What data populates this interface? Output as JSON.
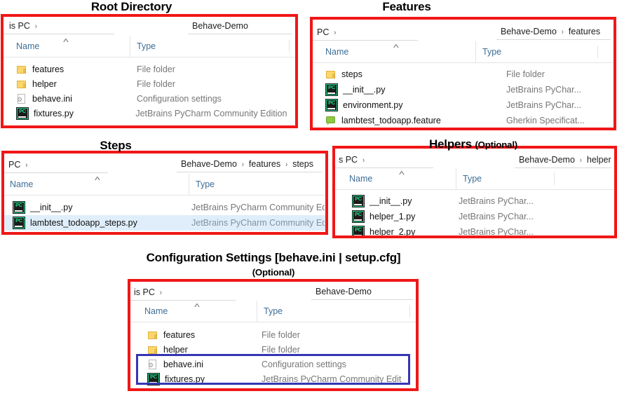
{
  "panels": [
    {
      "title": "Root Directory",
      "title_sub": "",
      "breadcrumb_left": "is PC",
      "breadcrumb_right": [
        "Behave-Demo"
      ],
      "columns": {
        "name": "Name",
        "type": "Type"
      },
      "rows": [
        {
          "name": "features",
          "type": "File folder",
          "icon": "folder-icon",
          "selected": false
        },
        {
          "name": "helper",
          "type": "File folder",
          "icon": "folder-icon",
          "selected": false
        },
        {
          "name": "behave.ini",
          "type": "Configuration settings",
          "icon": "ini-file-icon",
          "selected": false
        },
        {
          "name": "fixtures.py",
          "type": "JetBrains PyCharm Community Edition",
          "icon": "pycharm-icon",
          "selected": false
        }
      ]
    },
    {
      "title": "Features",
      "title_sub": "",
      "breadcrumb_left": "PC",
      "breadcrumb_right": [
        "Behave-Demo",
        "features"
      ],
      "columns": {
        "name": "Name",
        "type": "Type"
      },
      "rows": [
        {
          "name": "steps",
          "type": "File folder",
          "icon": "folder-icon",
          "selected": false
        },
        {
          "name": "__init__.py",
          "type": "JetBrains PyChar...",
          "icon": "pycharm-icon",
          "selected": false
        },
        {
          "name": "environment.py",
          "type": "JetBrains PyChar...",
          "icon": "pycharm-icon",
          "selected": false
        },
        {
          "name": "lambtest_todoapp.feature",
          "type": "Gherkin Specificat...",
          "icon": "gherkin-icon",
          "selected": false
        }
      ]
    },
    {
      "title": "Steps",
      "title_sub": "",
      "breadcrumb_left": "PC",
      "breadcrumb_right": [
        "Behave-Demo",
        "features",
        "steps"
      ],
      "columns": {
        "name": "Name",
        "type": "Type"
      },
      "rows": [
        {
          "name": "__init__.py",
          "type": "JetBrains PyCharm Community Ed",
          "icon": "pycharm-icon",
          "selected": false
        },
        {
          "name": "lambtest_todoapp_steps.py",
          "type": "JetBrains PyCharm Community Ed",
          "icon": "pycharm-icon",
          "selected": true
        }
      ]
    },
    {
      "title": "Helpers",
      "title_sub": "(Optional)",
      "breadcrumb_left": "s PC",
      "breadcrumb_right": [
        "Behave-Demo",
        "helper"
      ],
      "columns": {
        "name": "Name",
        "type": "Type"
      },
      "rows": [
        {
          "name": "__init__.py",
          "type": "JetBrains PyChar...",
          "icon": "pycharm-icon",
          "selected": false
        },
        {
          "name": "helper_1.py",
          "type": "JetBrains PyChar...",
          "icon": "pycharm-icon",
          "selected": false
        },
        {
          "name": "helper_2.py",
          "type": "JetBrains PyChar...",
          "icon": "pycharm-icon",
          "selected": false
        }
      ]
    },
    {
      "title": "Configuration Settings [behave.ini | setup.cfg]",
      "title_sub": "(Optional)",
      "breadcrumb_left": "is PC",
      "breadcrumb_right": [
        "Behave-Demo"
      ],
      "columns": {
        "name": "Name",
        "type": "Type"
      },
      "rows": [
        {
          "name": "features",
          "type": "File folder",
          "icon": "folder-icon",
          "selected": false
        },
        {
          "name": "helper",
          "type": "File folder",
          "icon": "folder-icon",
          "selected": false
        },
        {
          "name": "behave.ini",
          "type": "Configuration settings",
          "icon": "ini-file-icon",
          "selected": false,
          "highlight": true
        },
        {
          "name": "fixtures.py",
          "type": "JetBrains PyCharm Community Edition",
          "icon": "pycharm-icon",
          "selected": false,
          "highlight": true
        }
      ]
    }
  ],
  "icons": {
    "chevron": "›",
    "sort_caret": "˄",
    "gear": "⚙"
  },
  "colors": {
    "panel_border": "#f01717",
    "highlight_border": "#3636b5",
    "selected_row": "#dfeefa",
    "column_header_text": "#3d6e96",
    "type_text": "#777777",
    "folder": "#fdd66a",
    "pycharm_accent": "#21d789",
    "gherkin": "#8cc63f"
  }
}
